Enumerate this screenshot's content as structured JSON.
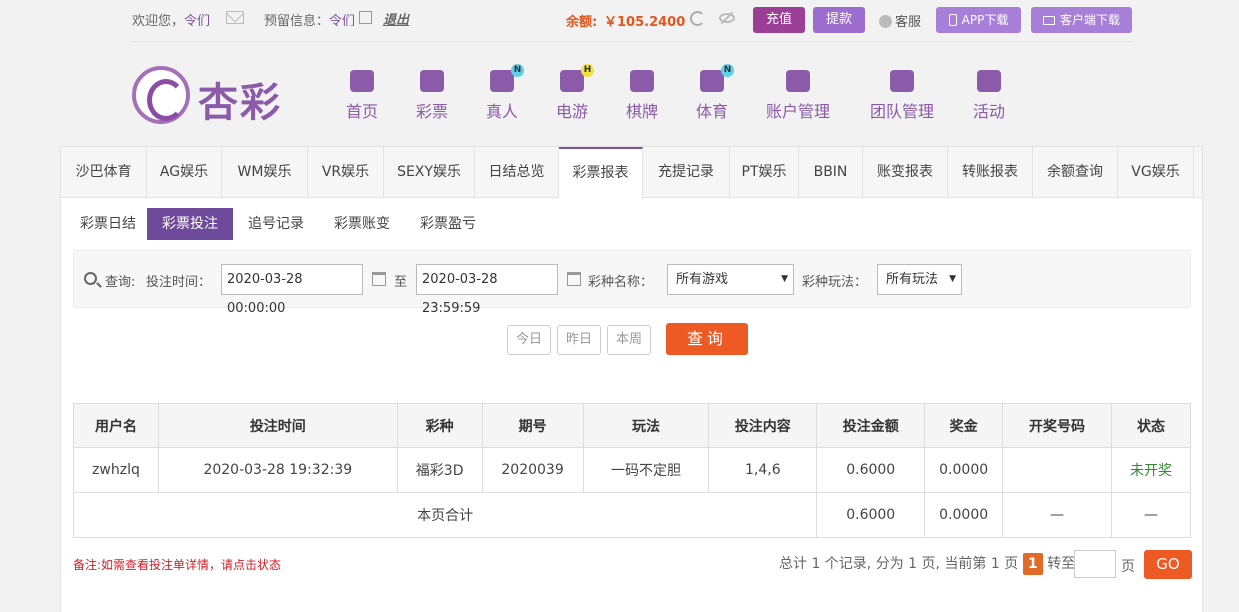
{
  "topbar": {
    "welcome": "欢迎您，",
    "username": "令们",
    "reserve_label": "预留信息：",
    "reserve_value": "令们",
    "logout": "退出",
    "balance_label": "余额:",
    "balance_value": "￥105.2400",
    "recharge": "充值",
    "withdraw": "提款",
    "service": "客服",
    "app_download": "APP下载",
    "client_download": "客户端下载"
  },
  "logo": {
    "text": "杏彩"
  },
  "nav": [
    {
      "label": "首页",
      "icon": "home-icon"
    },
    {
      "label": "彩票",
      "icon": "ticket-icon"
    },
    {
      "label": "真人",
      "icon": "dealer-icon",
      "badge": "N"
    },
    {
      "label": "电游",
      "icon": "gamepad-icon",
      "badge": "H"
    },
    {
      "label": "棋牌",
      "icon": "cards-icon"
    },
    {
      "label": "体育",
      "icon": "trophy-icon",
      "badge": "N"
    },
    {
      "label": "账户管理",
      "icon": "yen-icon"
    },
    {
      "label": "团队管理",
      "icon": "team-icon"
    },
    {
      "label": "活动",
      "icon": "gift-icon"
    }
  ],
  "tabs": [
    "沙巴体育",
    "AG娱乐",
    "WM娱乐",
    "VR娱乐",
    "SEXY娱乐",
    "日结总览",
    "彩票报表",
    "充提记录",
    "PT娱乐",
    "BBIN",
    "账变报表",
    "转账报表",
    "余额查询",
    "VG娱乐"
  ],
  "active_tab": "彩票报表",
  "subtabs": [
    "彩票日结",
    "彩票投注",
    "追号记录",
    "彩票账变",
    "彩票盈亏"
  ],
  "active_subtab": "彩票投注",
  "filter": {
    "query_label": "查询:",
    "time_label": "投注时间：",
    "start": "2020-03-28 00:00:00",
    "to": "至",
    "end": "2020-03-28 23:59:59",
    "lottery_label": "彩种名称：",
    "lottery_value": "所有游戏",
    "play_label": "彩种玩法：",
    "play_value": "所有玩法"
  },
  "quick": {
    "today": "今日",
    "yesterday": "昨日",
    "week": "本周",
    "query": "查询"
  },
  "table": {
    "headers": [
      "用户名",
      "投注时间",
      "彩种",
      "期号",
      "玩法",
      "投注内容",
      "投注金额",
      "奖金",
      "开奖号码",
      "状态"
    ],
    "rows": [
      [
        "zwhzlq",
        "2020-03-28 19:32:39",
        "福彩3D",
        "2020039",
        "一码不定胆",
        "1,4,6",
        "0.6000",
        "0.0000",
        "",
        "未开奖"
      ]
    ],
    "total_label": "本页合计",
    "total_amount": "0.6000",
    "total_bonus": "0.0000",
    "total_numbers": "—",
    "total_status": "—"
  },
  "note": "备注:如需查看投注单详情，请点击状态",
  "pager": {
    "summary": "总计 1 个记录, 分为 1 页, 当前第 1 页",
    "current": "1",
    "goto": "转至",
    "unit": "页",
    "go": "GO"
  },
  "colors": {
    "brand": "#8b5aa8",
    "accent": "#ee5a24",
    "status_pending": "#2e8b2e"
  }
}
